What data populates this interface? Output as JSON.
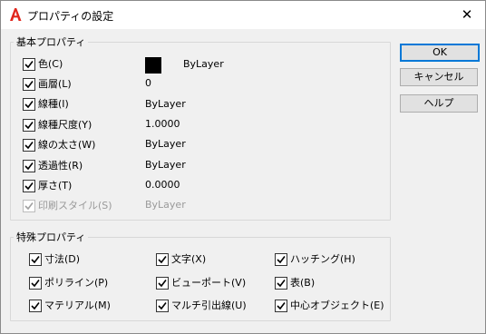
{
  "window": {
    "title": "プロパティの設定"
  },
  "basic": {
    "legend": "基本プロパティ",
    "items": [
      {
        "label": "色(C)",
        "value": "ByLayer"
      },
      {
        "label": "画層(L)",
        "value": "0"
      },
      {
        "label": "線種(I)",
        "value": "ByLayer"
      },
      {
        "label": "線種尺度(Y)",
        "value": "1.0000"
      },
      {
        "label": "線の太さ(W)",
        "value": "ByLayer"
      },
      {
        "label": "透過性(R)",
        "value": "ByLayer"
      },
      {
        "label": "厚さ(T)",
        "value": "0.0000"
      },
      {
        "label": "印刷スタイル(S)",
        "value": "ByLayer"
      }
    ],
    "color_swatch": "#000000"
  },
  "special": {
    "legend": "特殊プロパティ",
    "items": [
      {
        "label": "寸法(D)"
      },
      {
        "label": "文字(X)"
      },
      {
        "label": "ハッチング(H)"
      },
      {
        "label": "ポリライン(P)"
      },
      {
        "label": "ビューポート(V)"
      },
      {
        "label": "表(B)"
      },
      {
        "label": "マテリアル(M)"
      },
      {
        "label": "マルチ引出線(U)"
      },
      {
        "label": "中心オブジェクト(E)"
      }
    ]
  },
  "buttons": {
    "ok": "OK",
    "cancel": "キャンセル",
    "help": "ヘルプ"
  },
  "colors": {
    "accent": "#0078d7",
    "app_icon": "#e1261c"
  }
}
